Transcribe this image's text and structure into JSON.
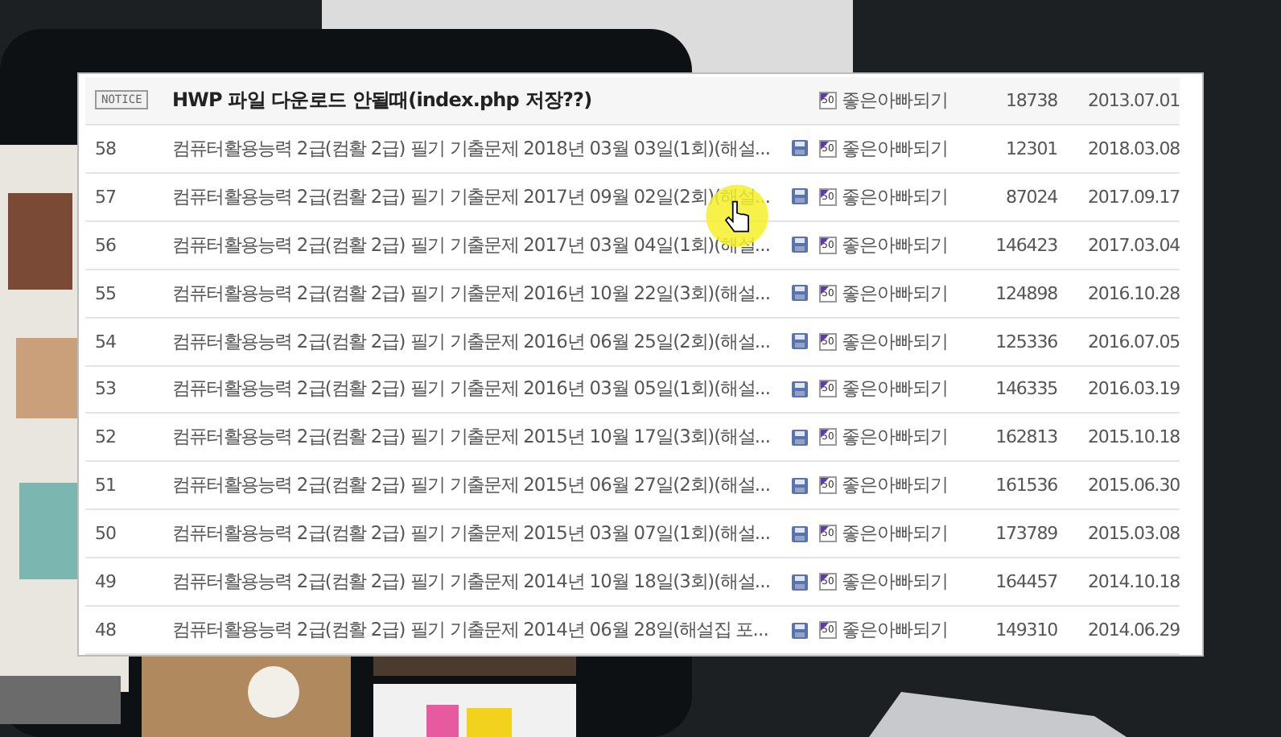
{
  "board": {
    "rows": [
      {
        "kind": "notice",
        "number": "NOTICE",
        "title": "HWP 파일 다운로드 안될때(index.php 저장??)",
        "attachment": false,
        "author_badge": "50",
        "author": "좋은아빠되기",
        "views": "18738",
        "date": "2013.07.01"
      },
      {
        "kind": "post",
        "number": "58",
        "title": "컴퓨터활용능력 2급(컴활 2급) 필기 기출문제 2018년 03월 03일(1회)(해설...",
        "attachment": true,
        "author_badge": "50",
        "author": "좋은아빠되기",
        "views": "12301",
        "date": "2018.03.08"
      },
      {
        "kind": "post",
        "number": "57",
        "title": "컴퓨터활용능력 2급(컴활 2급) 필기 기출문제 2017년 09월 02일(2회)(해설...",
        "attachment": true,
        "author_badge": "50",
        "author": "좋은아빠되기",
        "views": "87024",
        "date": "2017.09.17"
      },
      {
        "kind": "post",
        "number": "56",
        "title": "컴퓨터활용능력 2급(컴활 2급) 필기 기출문제 2017년 03월 04일(1회)(해설...",
        "attachment": true,
        "author_badge": "50",
        "author": "좋은아빠되기",
        "views": "146423",
        "date": "2017.03.04"
      },
      {
        "kind": "post",
        "number": "55",
        "title": "컴퓨터활용능력 2급(컴활 2급) 필기 기출문제 2016년 10월 22일(3회)(해설...",
        "attachment": true,
        "author_badge": "50",
        "author": "좋은아빠되기",
        "views": "124898",
        "date": "2016.10.28"
      },
      {
        "kind": "post",
        "number": "54",
        "title": "컴퓨터활용능력 2급(컴활 2급) 필기 기출문제 2016년 06월 25일(2회)(해설...",
        "attachment": true,
        "author_badge": "50",
        "author": "좋은아빠되기",
        "views": "125336",
        "date": "2016.07.05"
      },
      {
        "kind": "post",
        "number": "53",
        "title": "컴퓨터활용능력 2급(컴활 2급) 필기 기출문제 2016년 03월 05일(1회)(해설...",
        "attachment": true,
        "author_badge": "50",
        "author": "좋은아빠되기",
        "views": "146335",
        "date": "2016.03.19"
      },
      {
        "kind": "post",
        "number": "52",
        "title": "컴퓨터활용능력 2급(컴활 2급) 필기 기출문제 2015년 10월 17일(3회)(해설...",
        "attachment": true,
        "author_badge": "50",
        "author": "좋은아빠되기",
        "views": "162813",
        "date": "2015.10.18"
      },
      {
        "kind": "post",
        "number": "51",
        "title": "컴퓨터활용능력 2급(컴활 2급) 필기 기출문제 2015년 06월 27일(2회)(해설...",
        "attachment": true,
        "author_badge": "50",
        "author": "좋은아빠되기",
        "views": "161536",
        "date": "2015.06.30"
      },
      {
        "kind": "post",
        "number": "50",
        "title": "컴퓨터활용능력 2급(컴활 2급) 필기 기출문제 2015년 03월 07일(1회)(해설...",
        "attachment": true,
        "author_badge": "50",
        "author": "좋은아빠되기",
        "views": "173789",
        "date": "2015.03.08"
      },
      {
        "kind": "post",
        "number": "49",
        "title": "컴퓨터활용능력 2급(컴활 2급) 필기 기출문제 2014년 10월 18일(3회)(해설...",
        "attachment": true,
        "author_badge": "50",
        "author": "좋은아빠되기",
        "views": "164457",
        "date": "2014.10.18"
      },
      {
        "kind": "post",
        "number": "48",
        "title": "컴퓨터활용능력 2급(컴활 2급) 필기 기출문제 2014년 06월 28일(해설집 포...",
        "attachment": true,
        "author_badge": "50",
        "author": "좋은아빠되기",
        "views": "149310",
        "date": "2014.06.29"
      }
    ]
  }
}
